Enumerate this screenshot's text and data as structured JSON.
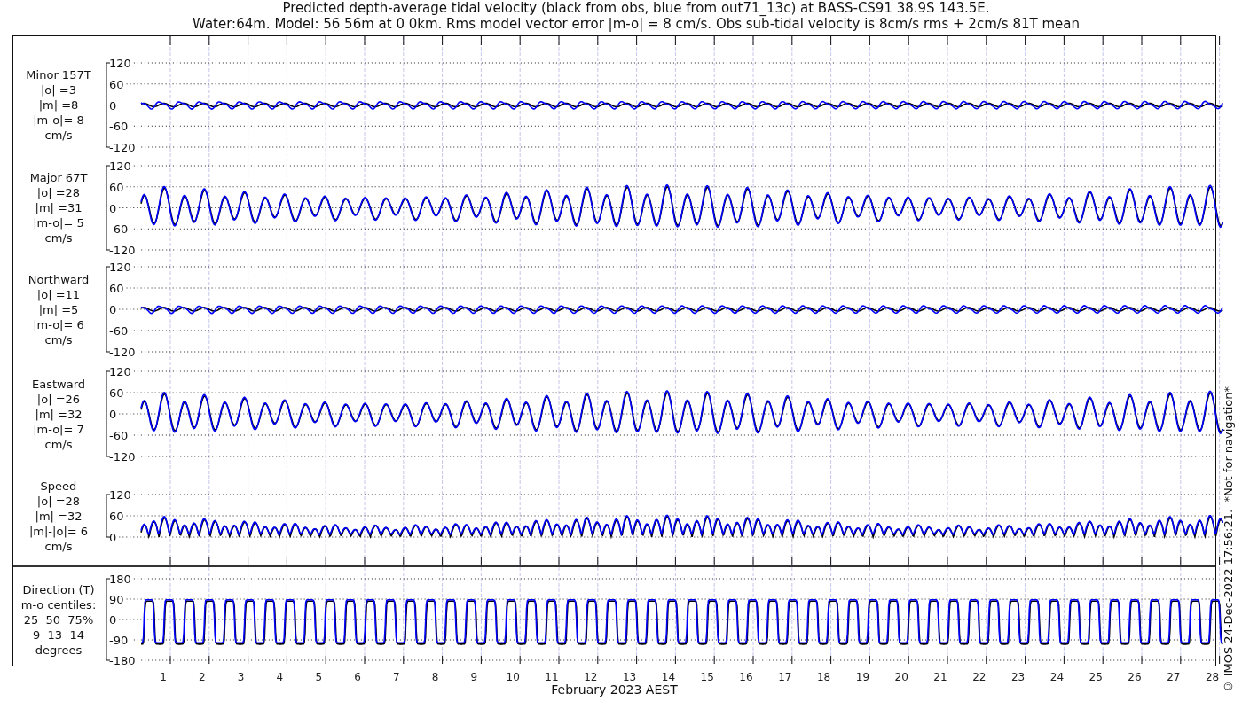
{
  "title_lines": [
    "Predicted depth-average tidal velocity (black from obs, blue from out71_13c) at BASS-CS91 38.9S 143.5E.",
    "Water:64m. Model: 56 56m at 0 0km. Rms model vector error |m-o| = 8 cm/s. Obs sub-tidal velocity is 8cm/s rms + 2cm/s 81T mean"
  ],
  "panels": [
    {
      "kind": "weak",
      "label_lines": [
        "Minor 157T",
        "|o| =3",
        "|m| =8",
        "|m-o|= 8",
        "cm/s"
      ],
      "ticks": [
        "120",
        "60",
        "0",
        "-60",
        "-120"
      ]
    },
    {
      "kind": "strong",
      "label_lines": [
        "Major 67T",
        "|o| =28",
        "|m| =31",
        "|m-o|= 5",
        "cm/s"
      ],
      "ticks": [
        "120",
        "60",
        "0",
        "-60",
        "-120"
      ]
    },
    {
      "kind": "weak",
      "label_lines": [
        "Northward",
        "|o| =11",
        "|m| =5",
        "|m-o|= 6",
        "cm/s"
      ],
      "ticks": [
        "120",
        "60",
        "0",
        "-60",
        "-120"
      ]
    },
    {
      "kind": "strong",
      "label_lines": [
        "Eastward",
        "|o| =26",
        "|m| =32",
        "|m-o|= 7",
        "cm/s"
      ],
      "ticks": [
        "120",
        "60",
        "0",
        "-60",
        "-120"
      ]
    },
    {
      "kind": "speed",
      "label_lines": [
        "Speed",
        "|o| =28",
        "|m| =32",
        "|m|-|o|= 6",
        "cm/s"
      ],
      "ticks": [
        "120",
        "60",
        "0"
      ]
    },
    {
      "kind": "direction",
      "label_lines": [
        "Direction (T)",
        "m-o centiles:",
        "25  50  75%",
        "9  13  14",
        "degrees"
      ],
      "ticks": [
        "180",
        "90",
        "0",
        "-90",
        "-180"
      ]
    }
  ],
  "x_axis": {
    "day_labels": [
      "1",
      "2",
      "3",
      "4",
      "5",
      "6",
      "7",
      "8",
      "9",
      "10",
      "11",
      "12",
      "13",
      "14",
      "15",
      "16",
      "17",
      "18",
      "19",
      "20",
      "21",
      "22",
      "23",
      "24",
      "25",
      "26",
      "27",
      "28"
    ],
    "label": "February 2023 AEST"
  },
  "footnote": "© IMOS 24-Dec-2022 17:56:21.  *Not for navigation*"
}
